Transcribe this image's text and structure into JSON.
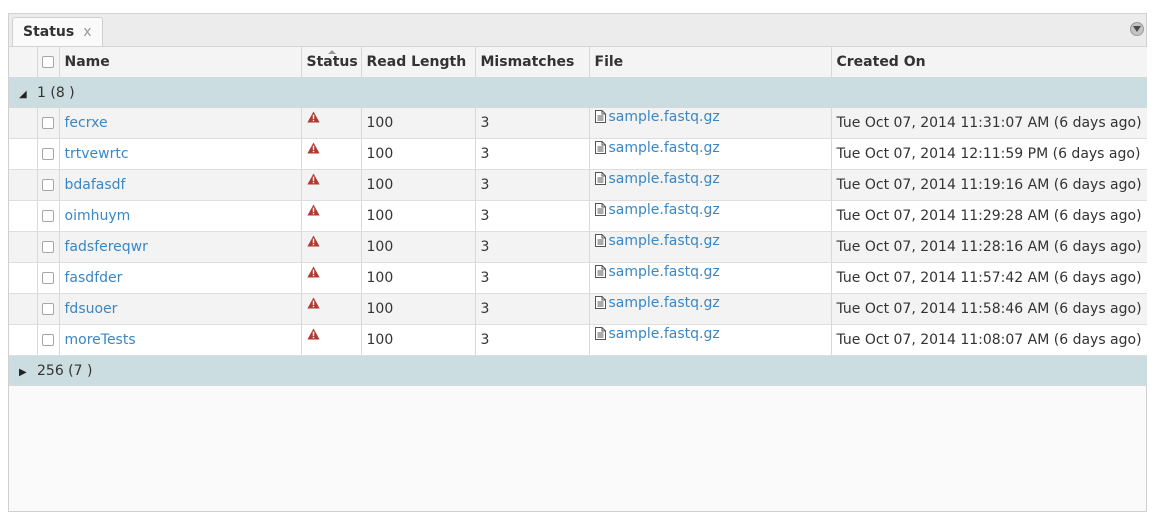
{
  "tab": {
    "label": "Status",
    "close": "x"
  },
  "columns": [
    {
      "key": "select",
      "label": ""
    },
    {
      "key": "name",
      "label": "Name"
    },
    {
      "key": "status",
      "label": "Status"
    },
    {
      "key": "read_length",
      "label": "Read Length"
    },
    {
      "key": "mismatches",
      "label": "Mismatches"
    },
    {
      "key": "file",
      "label": "File"
    },
    {
      "key": "created_on",
      "label": "Created On"
    }
  ],
  "groups": [
    {
      "label": "1 (8 )",
      "expanded": true,
      "rows": [
        {
          "name": "fecrxe",
          "status_icon": "warning-icon",
          "read_length": "100",
          "mismatches": "3",
          "file": "sample.fastq.gz",
          "created_on": "Tue Oct 07, 2014 11:31:07 AM (6 days ago)"
        },
        {
          "name": "trtvewrtc",
          "status_icon": "warning-icon",
          "read_length": "100",
          "mismatches": "3",
          "file": "sample.fastq.gz",
          "created_on": "Tue Oct 07, 2014 12:11:59 PM (6 days ago)"
        },
        {
          "name": "bdafasdf",
          "status_icon": "warning-icon",
          "read_length": "100",
          "mismatches": "3",
          "file": "sample.fastq.gz",
          "created_on": "Tue Oct 07, 2014 11:19:16 AM (6 days ago)"
        },
        {
          "name": "oimhuym",
          "status_icon": "warning-icon",
          "read_length": "100",
          "mismatches": "3",
          "file": "sample.fastq.gz",
          "created_on": "Tue Oct 07, 2014 11:29:28 AM (6 days ago)"
        },
        {
          "name": "fadsfereqwr",
          "status_icon": "warning-icon",
          "read_length": "100",
          "mismatches": "3",
          "file": "sample.fastq.gz",
          "created_on": "Tue Oct 07, 2014 11:28:16 AM (6 days ago)"
        },
        {
          "name": "fasdfder",
          "status_icon": "warning-icon",
          "read_length": "100",
          "mismatches": "3",
          "file": "sample.fastq.gz",
          "created_on": "Tue Oct 07, 2014 11:57:42 AM (6 days ago)"
        },
        {
          "name": "fdsuoer",
          "status_icon": "warning-icon",
          "read_length": "100",
          "mismatches": "3",
          "file": "sample.fastq.gz",
          "created_on": "Tue Oct 07, 2014 11:58:46 AM (6 days ago)"
        },
        {
          "name": "moreTests",
          "status_icon": "warning-icon",
          "read_length": "100",
          "mismatches": "3",
          "file": "sample.fastq.gz",
          "created_on": "Tue Oct 07, 2014 11:08:07 AM (6 days ago)"
        }
      ]
    },
    {
      "label": "256 (7 )",
      "expanded": false,
      "rows": []
    }
  ],
  "sort": {
    "column": "status",
    "direction": "asc"
  },
  "colors": {
    "link": "#3a87c4",
    "group_bg": "#cbdde0",
    "warning": "#b03a32"
  }
}
